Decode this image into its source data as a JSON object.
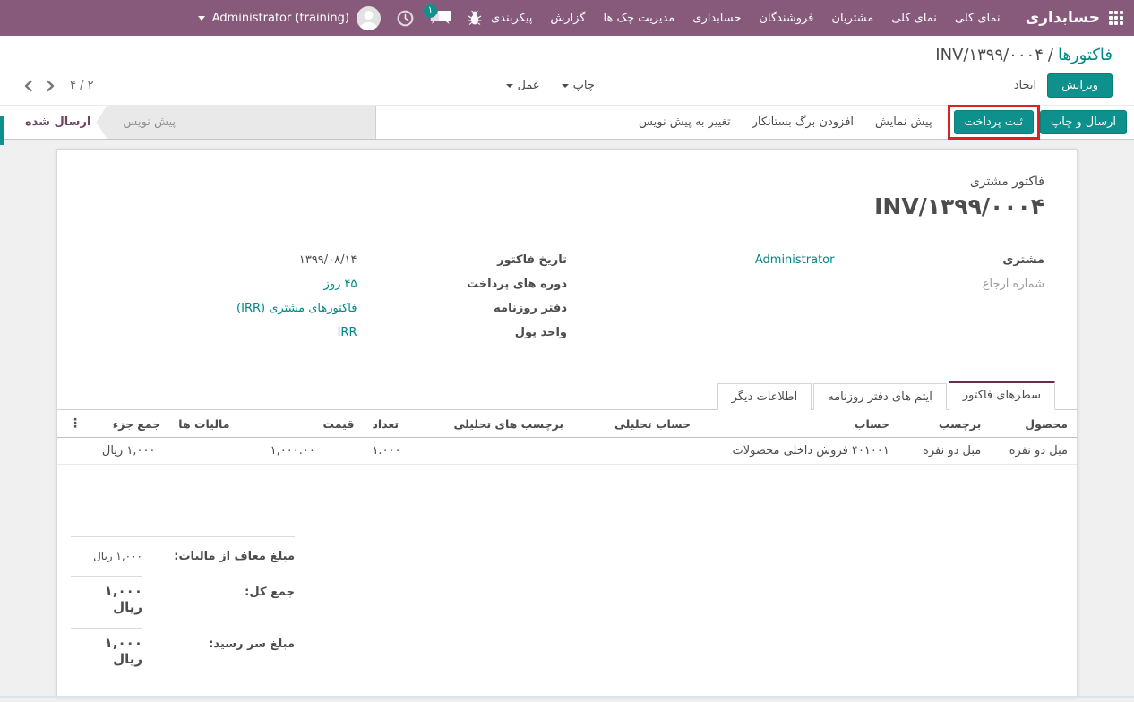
{
  "topbar": {
    "app_name": "حسابداری",
    "menus": [
      "نمای کلی",
      "نمای کلی",
      "مشتریان",
      "فروشندگان",
      "حسابداری",
      "مدیریت چک ها",
      "گزارش",
      "پیکربندی"
    ],
    "user_name": "Administrator (training)",
    "message_count": "۱"
  },
  "breadcrumb": {
    "parent": "فاکتورها",
    "separator": "/",
    "current": "INV/۱۳۹۹/۰۰۰۴"
  },
  "control": {
    "edit": "ویرایش",
    "create": "ایجاد",
    "print": "چاپ",
    "action": "عمل",
    "pager": "۲ / ۴"
  },
  "actions": {
    "send_and_print": "ارسال و چاپ",
    "register_payment": "ثبت پرداخت",
    "preview": "پیش نمایش",
    "add_credit_note": "افزودن برگ بستانکار",
    "reset_to_draft": "تغییر به پیش نویس"
  },
  "statusbar": {
    "states": [
      {
        "label": "پیش نویس",
        "active": false
      },
      {
        "label": "ارسال شده",
        "active": true
      }
    ]
  },
  "invoice": {
    "doc_type": "فاکتور مشتری",
    "number": "INV/۱۳۹۹/۰۰۰۴",
    "customer": {
      "label": "مشتری",
      "value": "Administrator"
    },
    "reference": {
      "label": "شماره ارجاع",
      "value": ""
    },
    "details": [
      {
        "label": "تاریخ فاکتور",
        "value": "۱۳۹۹/۰۸/۱۴",
        "link": false
      },
      {
        "label": "دوره های پرداخت",
        "value": "۴۵ روز",
        "link": true
      },
      {
        "label": "دفتر روزنامه",
        "value": "فاکتورهای مشتری (IRR)",
        "link": true
      },
      {
        "label": "واحد پول",
        "value": "IRR",
        "link": true
      }
    ],
    "tabs": [
      {
        "label": "سطرهای فاکتور",
        "active": true
      },
      {
        "label": "آیتم های دفتر روزنامه",
        "active": false
      },
      {
        "label": "اطلاعات دیگر",
        "active": false
      }
    ],
    "table": {
      "headers": [
        "محصول",
        "برچسب",
        "حساب",
        "حساب تحلیلی",
        "برچسب های تحلیلی",
        "تعداد",
        "قیمت",
        "مالیات ها",
        "جمع جزء"
      ],
      "row": {
        "product": "مبل دو نفره",
        "label": "مبل دو نفره",
        "account": "۴۰۱۰۰۱ فروش داخلی محصولات",
        "analytic_account": "",
        "analytic_tags": "",
        "quantity": "۱.۰۰۰",
        "price": "۱,۰۰۰.۰۰",
        "taxes": "",
        "subtotal": "۱,۰۰۰ ریال"
      }
    },
    "totals": [
      {
        "label": "مبلغ معاف از مالیات:",
        "value": "۱,۰۰۰ ریال",
        "bold": false
      },
      {
        "label": "جمع کل:",
        "value": "۱,۰۰۰ ریال",
        "bold": true
      },
      {
        "label": "مبلغ سر رسید:",
        "value": "۱,۰۰۰ ریال",
        "bold": true
      }
    ]
  },
  "icons": {
    "column_options": "⋮"
  },
  "colors": {
    "topbar": "#875a7b",
    "primary_button": "#0e918c",
    "link": "#008784",
    "annotation_highlight": "#e01f1f",
    "active_tab_border": "#662e4d"
  }
}
